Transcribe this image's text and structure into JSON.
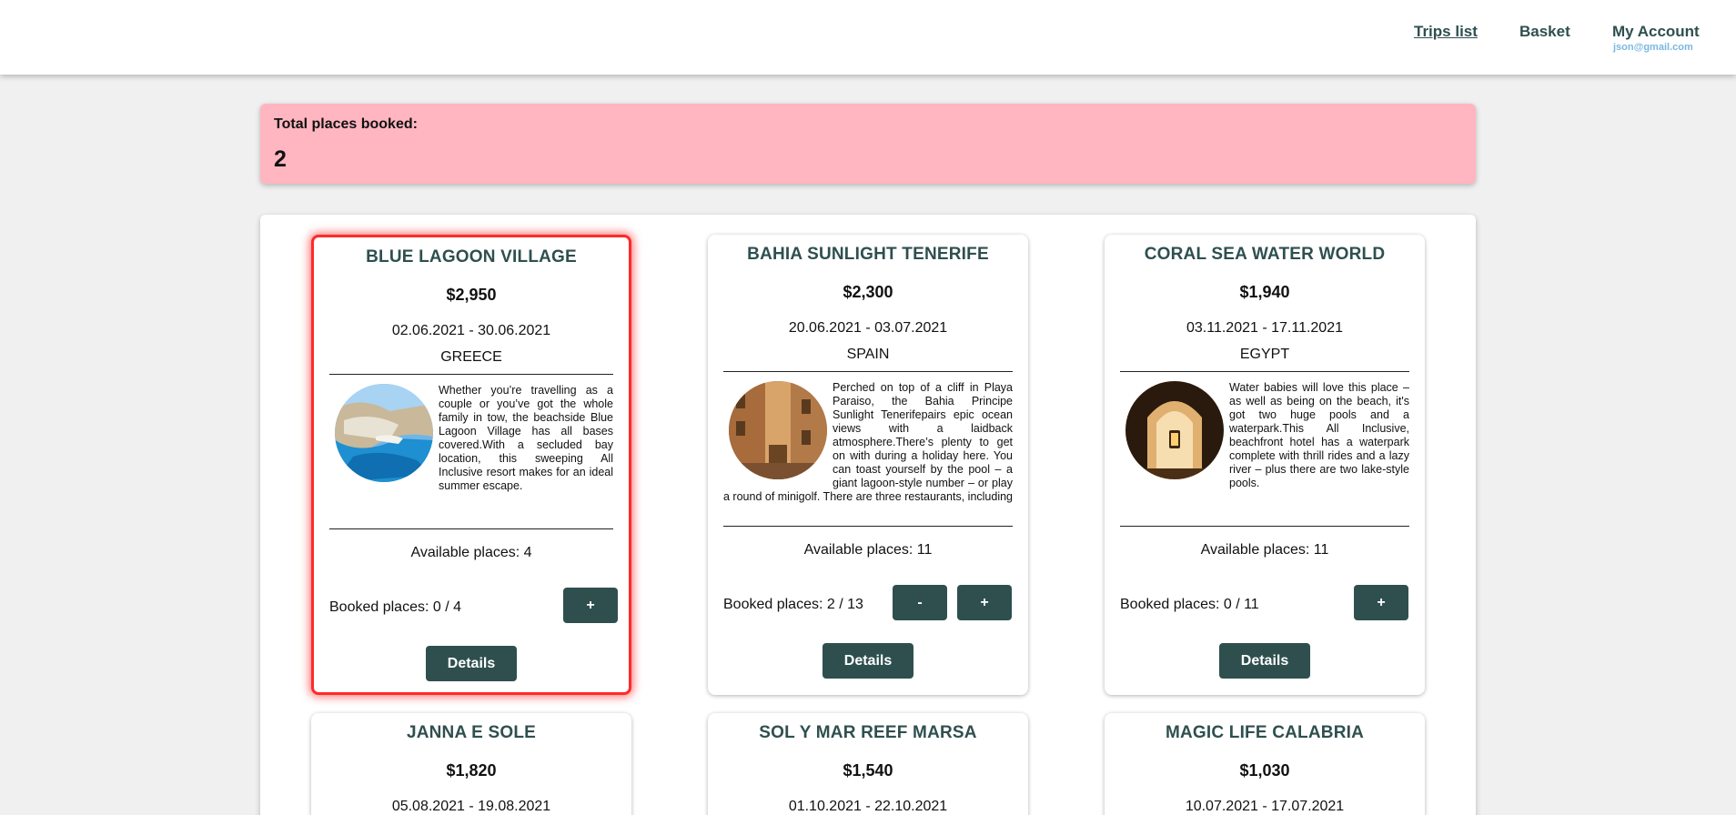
{
  "nav": {
    "trips_list": "Trips list",
    "basket": "Basket",
    "my_account": "My Account",
    "email": "json@gmail.com"
  },
  "summary": {
    "label": "Total places booked:",
    "value": "2"
  },
  "colors": {
    "primary": "#2f4f4f",
    "summary_bg": "#ffb6c1",
    "highlight_border": "#ff2a2a",
    "email": "#7ab8e0"
  },
  "trips": [
    {
      "name": "BLUE LAGOON VILLAGE",
      "price": "$2,950",
      "dates": "02.06.2021 - 30.06.2021",
      "country": "GREECE",
      "description": "Whether you’re travelling as a couple or you’ve got the whole family in tow, the beachside Blue Lagoon Village has all bases covered.With a secluded bay location, this sweeping All Inclusive resort makes for an ideal summer escape.",
      "image_icon": "beach-cove-photo",
      "available": "Available places: 4",
      "booked": "Booked places: 0 / 4",
      "minus_label": "-",
      "plus_label": "+",
      "details_label": "Details"
    },
    {
      "name": "BAHIA SUNLIGHT TENERIFE",
      "price": "$2,300",
      "dates": "20.06.2021 - 03.07.2021",
      "country": "SPAIN",
      "description": "Perched on top of a cliff in Playa Paraiso, the Bahia Principe Sunlight Tenerifepairs epic ocean views with a laidback atmosphere.There’s plenty to get on with during a holiday here. You can toast yourself by the pool – a giant lagoon-style number – or play a round of minigolf. There are three restaurants, including a Mexican place.You’re also able to use the",
      "image_icon": "old-town-street-photo",
      "available": "Available places: 11",
      "booked": "Booked places: 2 / 13",
      "minus_label": "-",
      "plus_label": "+",
      "details_label": "Details"
    },
    {
      "name": "CORAL SEA WATER WORLD",
      "price": "$1,940",
      "dates": "03.11.2021 - 17.11.2021",
      "country": "EGYPT",
      "description": "Water babies will love this place – as well as being on the beach, it's got two huge pools and a waterpark.This All Inclusive, beachfront hotel has a waterpark complete with thrill rides and a lazy river – plus there are two lake-style pools.",
      "image_icon": "lantern-arch-photo",
      "available": "Available places: 11",
      "booked": "Booked places: 0 / 11",
      "minus_label": "-",
      "plus_label": "+",
      "details_label": "Details"
    },
    {
      "name": "JANNA E SOLE",
      "price": "$1,820",
      "dates": "05.08.2021 - 19.08.2021"
    },
    {
      "name": "SOL Y MAR REEF MARSA",
      "price": "$1,540",
      "dates": "01.10.2021 - 22.10.2021"
    },
    {
      "name": "MAGIC LIFE CALABRIA",
      "price": "$1,030",
      "dates": "10.07.2021 - 17.07.2021"
    }
  ]
}
